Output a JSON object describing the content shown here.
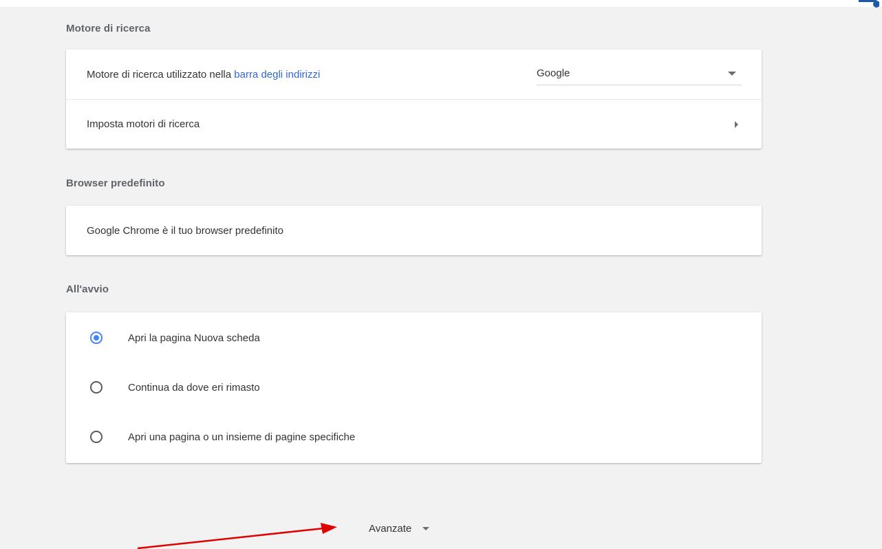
{
  "search_engine": {
    "title": "Motore di ricerca",
    "row1_text": "Motore di ricerca utilizzato nella ",
    "row1_link": "barra degli indirizzi",
    "selected_engine": "Google",
    "row2_text": "Imposta motori di ricerca"
  },
  "default_browser": {
    "title": "Browser predefinito",
    "status_text": "Google Chrome è il tuo browser predefinito"
  },
  "startup": {
    "title": "All'avvio",
    "options": [
      {
        "label": "Apri la pagina Nuova scheda",
        "checked": true
      },
      {
        "label": "Continua da dove eri rimasto",
        "checked": false
      },
      {
        "label": "Apri una pagina o un insieme di pagine specifiche",
        "checked": false
      }
    ]
  },
  "advanced": {
    "label": "Avanzate"
  },
  "colors": {
    "accent": "#4285f4",
    "link": "#3367d6",
    "annotation_arrow": "#e00000",
    "background": "#f2f2f2"
  },
  "icons": {
    "dropdown": "chevron-down-icon",
    "navigate": "chevron-right-icon",
    "expand": "chevron-down-icon"
  }
}
